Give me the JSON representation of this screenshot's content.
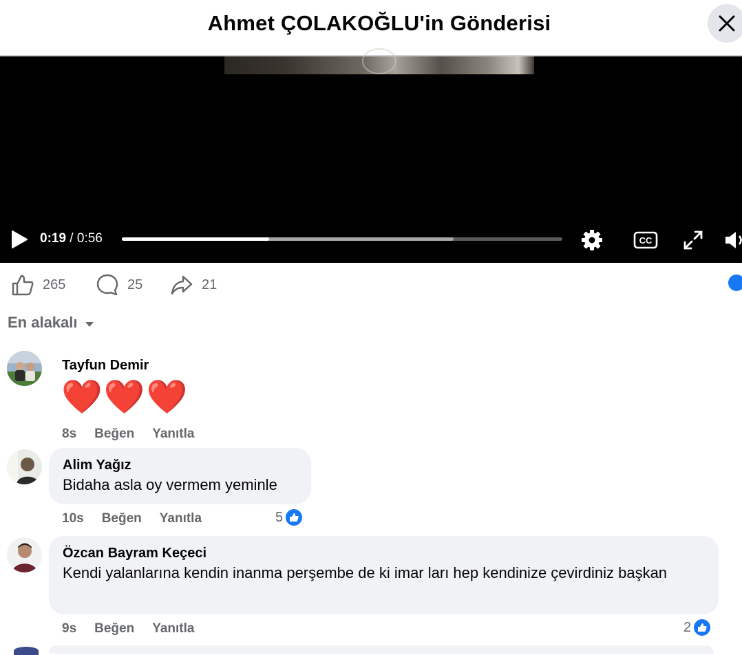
{
  "header": {
    "title": "Ahmet ÇOLAKOĞLU'in Gönderisi",
    "close_icon": "close-icon"
  },
  "video": {
    "current_time": "0:19",
    "separator": " / ",
    "duration": "0:56",
    "progress_fraction": 0.335,
    "buffered_fraction": 0.753,
    "icons": [
      "play-icon",
      "settings-gear-icon",
      "closed-captions-icon",
      "fullscreen-icon",
      "volume-icon"
    ]
  },
  "actions": {
    "likes": "265",
    "comments": "25",
    "shares": "21"
  },
  "sort": {
    "label": "En alakalı"
  },
  "comments": [
    {
      "author": "Tayfun Demir",
      "text": "❤️❤️❤️",
      "time": "8s",
      "like_label": "Beğen",
      "reply_label": "Yanıtla",
      "reactions": ""
    },
    {
      "author": "Alim Yağız",
      "text": "Bidaha asla oy vermem yeminle",
      "time": "10s",
      "like_label": "Beğen",
      "reply_label": "Yanıtla",
      "reactions": "5"
    },
    {
      "author": "Özcan Bayram Keçeci",
      "text": "Kendi yalanlarına kendin inanma perşembe de ki imar ları hep kendinize çevirdiniz başkan",
      "time": "9s",
      "like_label": "Beğen",
      "reply_label": "Yanıtla",
      "reactions": "2"
    }
  ],
  "colors": {
    "accent": "#1877f2",
    "muted": "#65676b",
    "bubble": "#f0f2f5",
    "video_bg": "#000000"
  }
}
